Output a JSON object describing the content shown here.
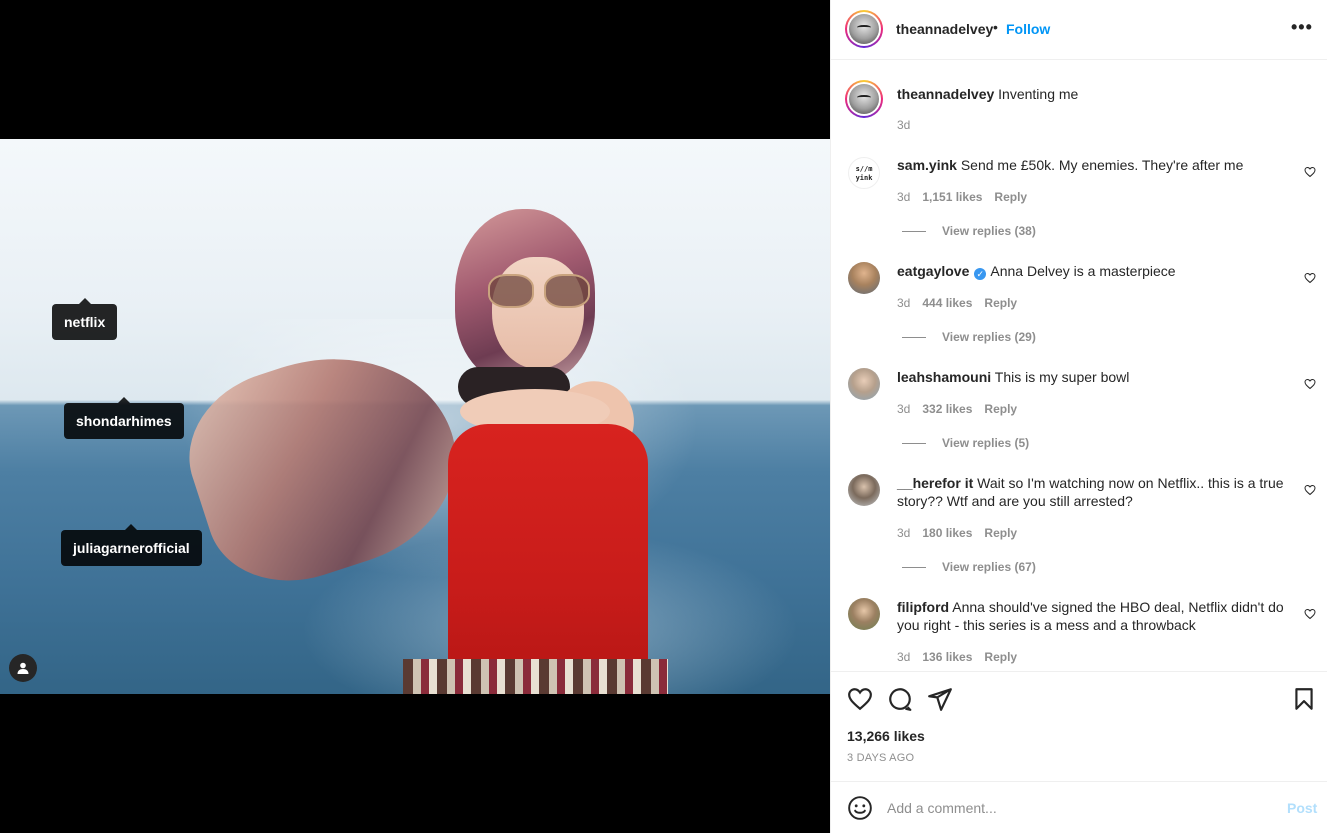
{
  "media": {
    "tags": [
      {
        "label": "netflix"
      },
      {
        "label": "shondarhimes"
      },
      {
        "label": "juliagarnerofficial"
      }
    ]
  },
  "header": {
    "username": "theannadelvey",
    "dot": "•",
    "follow_label": "Follow",
    "more_label": "•••"
  },
  "caption": {
    "username": "theannadelvey",
    "text": "Inventing me",
    "time": "3d"
  },
  "comments": [
    {
      "username": "sam.yink",
      "text": "Send me £50k. My enemies. They're after me",
      "time": "3d",
      "likes": "1,151 likes",
      "reply": "Reply",
      "replies": "View replies (38)",
      "avatar_text": "s//m\nyink"
    },
    {
      "username": "eatgaylove",
      "text": "Anna Delvey is a masterpiece",
      "time": "3d",
      "likes": "444 likes",
      "reply": "Reply",
      "replies": "View replies (29)",
      "verified": true
    },
    {
      "username": "leahshamouni",
      "text": "This is my super bowl",
      "time": "3d",
      "likes": "332 likes",
      "reply": "Reply",
      "replies": "View replies (5)"
    },
    {
      "username": "__herefor it",
      "text": "Wait so I'm watching now on Netflix.. this is a true story?? Wtf and are you still arrested?",
      "time": "3d",
      "likes": "180 likes",
      "reply": "Reply",
      "replies": "View replies (67)"
    },
    {
      "username": "filipford",
      "text": "Anna should've signed the HBO deal, Netflix didn't do you right - this series is a mess and a throwback",
      "time": "3d",
      "likes": "136 likes",
      "reply": "Reply"
    }
  ],
  "actions": {
    "likes": "13,266 likes",
    "time": "3 DAYS AGO"
  },
  "add_comment": {
    "placeholder": "Add a comment...",
    "post_label": "Post"
  },
  "colors": {
    "accent": "#0095f6",
    "post_disabled": "#b2dffc",
    "muted": "#8e8e8e"
  }
}
